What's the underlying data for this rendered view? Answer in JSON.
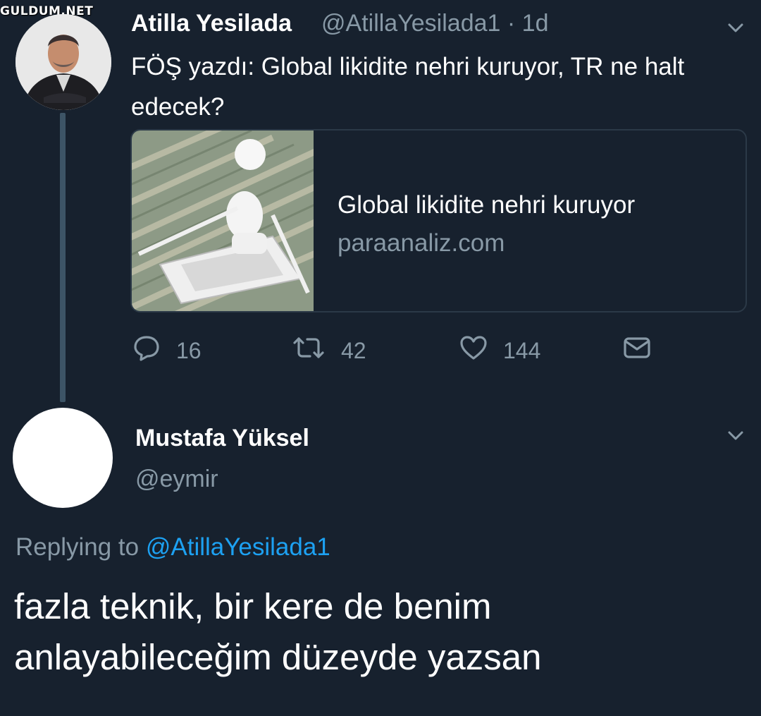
{
  "watermark": "GULDUM.NET",
  "tweet": {
    "author_name": "Atilla Yesilada",
    "author_handle": "@AtillaYesilada1",
    "time": "1d",
    "text": "FÖŞ yazdı:  Global likidite nehri kuruyor, TR ne halt edecek?",
    "card": {
      "title": "Global likidite nehri kuruyor",
      "domain": "paraanaliz.com"
    },
    "actions": {
      "replies": "16",
      "retweets": "42",
      "likes": "144"
    }
  },
  "reply": {
    "author_name": "Mustafa Yüksel",
    "author_handle": "@eymir",
    "replying_prefix": "Replying to",
    "replying_to": "@AtillaYesilada1",
    "text": "fazla teknik, bir kere de benim anlayabileceğim düzeyde yazsan"
  },
  "icons": {
    "reply": "reply-icon",
    "retweet": "retweet-icon",
    "like": "heart-icon",
    "dm": "envelope-icon",
    "menu": "chevron-down-icon"
  },
  "colors": {
    "background": "#17212e",
    "secondary_text": "#8899a6",
    "link": "#1da1f2"
  }
}
